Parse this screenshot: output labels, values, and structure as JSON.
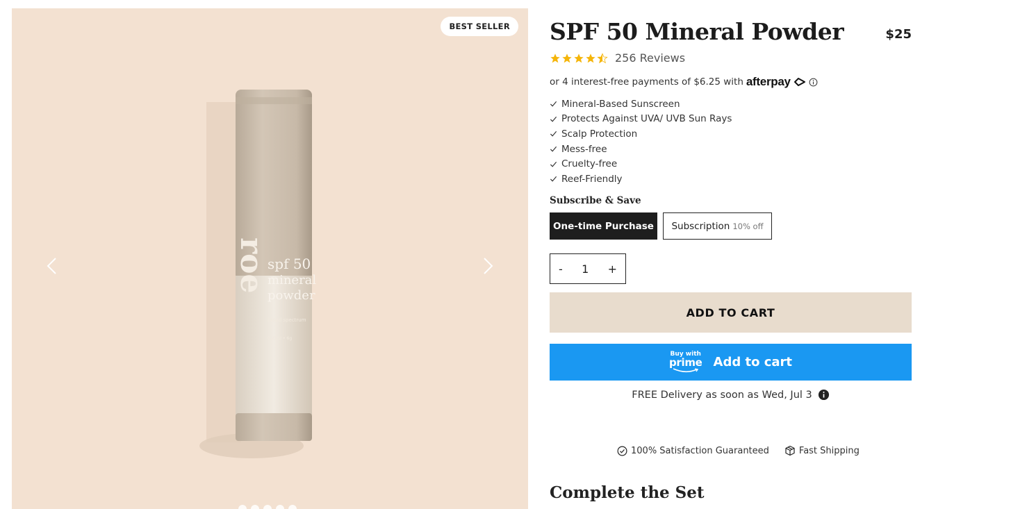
{
  "product": {
    "badge": "BEST SELLER",
    "title": "SPF 50 Mineral Powder",
    "price": "$25",
    "rating": 4.5,
    "reviews_label": "256 Reviews",
    "tube_text": {
      "brand": "roe",
      "line1": "spf 50",
      "line2": "mineral",
      "line3": "powder",
      "line4": "broad spectrum",
      "line5": "0.21oz • 6g"
    }
  },
  "gallery": {
    "slide_count": 5,
    "active_slide": 1
  },
  "afterpay": {
    "text": "or 4 interest-free payments of $6.25 with",
    "brand": "afterpay"
  },
  "features": [
    "Mineral-Based Sunscreen",
    "Protects Against UVA/ UVB Sun Rays",
    "Scalp Protection",
    "Mess-free",
    "Cruelty-free",
    "Reef-Friendly"
  ],
  "subscribe": {
    "label": "Subscribe & Save",
    "one_time": "One-time Purchase",
    "subscription": "Subscription",
    "subscription_discount": "10% off"
  },
  "quantity": {
    "minus": "-",
    "value": "1",
    "plus": "+"
  },
  "buttons": {
    "add_to_cart": "ADD TO CART",
    "prime_small": "Buy with",
    "prime_logo": "prime",
    "prime_label": "Add to cart"
  },
  "delivery": {
    "text": "FREE Delivery as soon as Wed, Jul 3"
  },
  "guarantees": {
    "satisfaction": "100% Satisfaction Guaranteed",
    "shipping": "Fast Shipping"
  },
  "sections": {
    "complete_set": "Complete the Set"
  },
  "colors": {
    "gallery_bg": "#f3e1d1",
    "add_to_cart_bg": "#e8dccd",
    "prime_bg": "#1a98f2",
    "star": "#f5b50a"
  }
}
